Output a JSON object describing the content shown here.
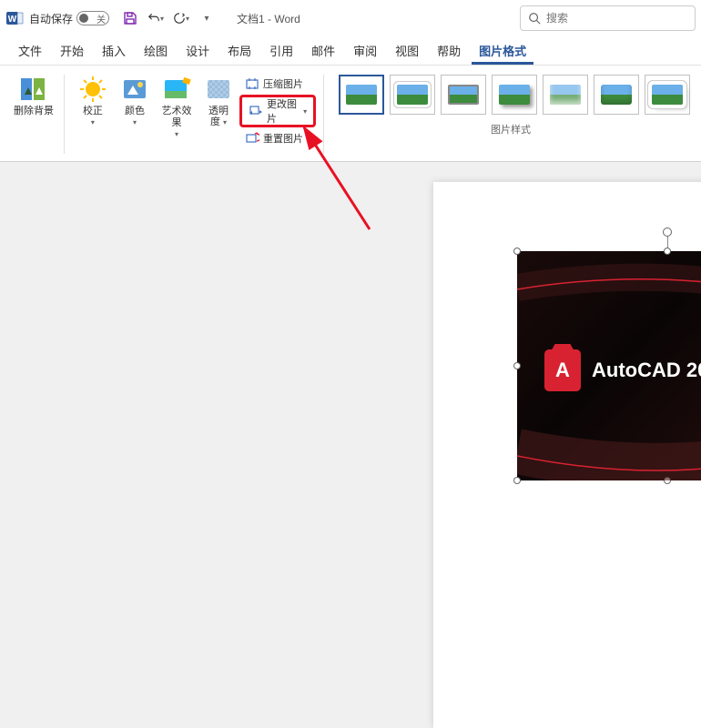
{
  "titlebar": {
    "autosave_label": "自动保存",
    "autosave_off": "关",
    "doc_title": "文档1 - Word",
    "search_placeholder": "搜索"
  },
  "tabs": {
    "items": [
      {
        "label": "文件"
      },
      {
        "label": "开始"
      },
      {
        "label": "插入"
      },
      {
        "label": "绘图"
      },
      {
        "label": "设计"
      },
      {
        "label": "布局"
      },
      {
        "label": "引用"
      },
      {
        "label": "邮件"
      },
      {
        "label": "审阅"
      },
      {
        "label": "视图"
      },
      {
        "label": "帮助"
      },
      {
        "label": "图片格式"
      }
    ],
    "active_index": 11
  },
  "ribbon": {
    "remove_bg": "删除背景",
    "corrections": "校正",
    "color": "颜色",
    "artistic": "艺术效果",
    "transparency_l1": "透明",
    "transparency_l2": "度",
    "compress": "压缩图片",
    "change": "更改图片",
    "reset": "重置图片",
    "styles_label": "图片样式"
  },
  "picture": {
    "brand_letter": "A",
    "brand_text": "AutoCAD 20"
  }
}
